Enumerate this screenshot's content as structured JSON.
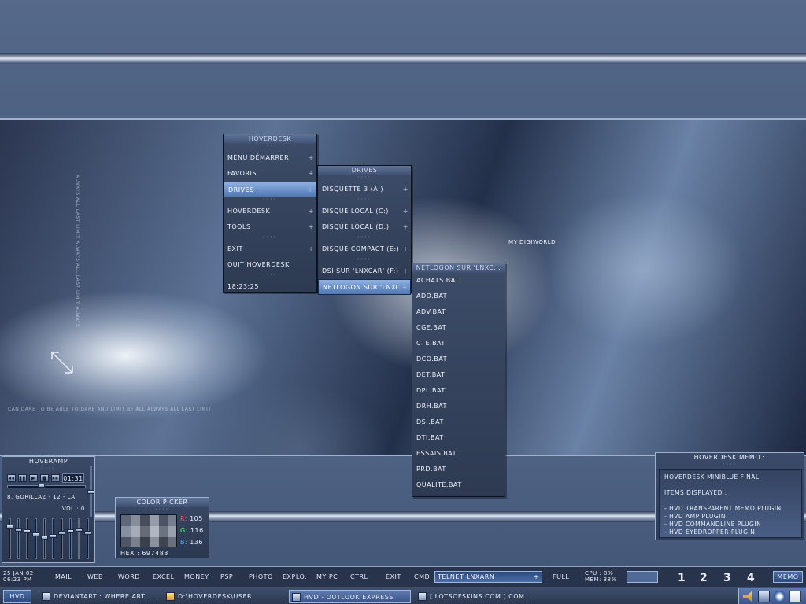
{
  "wallpaper": {
    "caption": "MY DIGIWORLD",
    "vertical_text": "ALWAYS ALL LAST LIMIT ALWAYS ALL LAST LIMIT ALWAYS",
    "bottom_text": "CAN DARE TO BE ABLE TO DARE AND LIMIT BE ALL ALWAYS ALL LAST LIMIT"
  },
  "menus": {
    "main": {
      "title": "HOVERDESK",
      "items": [
        "MENU DÉMARRER",
        "FAVORIS",
        "DRIVES",
        "HOVERDESK",
        "TOOLS",
        "EXIT",
        "QUIT HOVERDESK",
        "18:23:25"
      ]
    },
    "drives": {
      "title": "DRIVES",
      "items": [
        "DISQUETTE 3 (A:)",
        "DISQUE LOCAL (C:)",
        "DISQUE LOCAL (D:)",
        "DISQUE COMPACT (E:)",
        "DSI SUR 'LNXCAR' (F:)",
        "NETLOGON SUR 'LNXC..."
      ]
    },
    "netlogon": {
      "title": "NETLOGON SUR 'LNXC...",
      "items": [
        "ACHATS.BAT",
        "ADD.BAT",
        "ADV.BAT",
        "CGE.BAT",
        "CTE.BAT",
        "DCO.BAT",
        "DET.BAT",
        "DPL.BAT",
        "DRH.BAT",
        "DSI.BAT",
        "DTI.BAT",
        "ESSAIS.BAT",
        "PRD.BAT",
        "QUALITE.BAT"
      ]
    },
    "arrow": "+"
  },
  "hoveramp": {
    "title": "HOVERAMP",
    "time": "01:31",
    "track": "8. GORILLAZ - 12 - LA",
    "volume": "VOL : 0",
    "controls": [
      "◂◂",
      "▮▮",
      "▶",
      "■",
      "▸▸"
    ]
  },
  "color_picker": {
    "title": "COLOR PICKER",
    "r_label": "R:",
    "r_value": "105",
    "g_label": "G:",
    "g_value": "116",
    "b_label": "B:",
    "b_value": "136",
    "hex_label": "HEX : 697488",
    "swatch_color": "#697488"
  },
  "memo": {
    "title": "HOVERDESK MEMO :",
    "line1": "HOVERDESK MINIBLUE FINAL",
    "line2": "ITEMS DISPLAYED :",
    "items": [
      "- HVD TRANSPARENT MEMO PLUGIN",
      "- HVD AMP PLUGIN",
      "- HVD COMMANDLINE PLUGIN",
      "- HVD EYEDROPPER PLUGIN"
    ]
  },
  "taskbar": {
    "date": "25 JAN 02",
    "time": "06:23 PM",
    "links": [
      "MAIL",
      "WEB",
      "WORD",
      "EXCEL",
      "MONEY",
      "PSP",
      "PHOTO",
      "EXPLO.",
      "MY PC",
      "CTRL",
      "EXIT"
    ],
    "cmd_label": "CMD:",
    "cmd_value": "TELNET LNXARN",
    "full_label": "FULL",
    "cpu": "CPU : 0%",
    "mem": "MEM: 38%",
    "desktops": [
      "1",
      "2",
      "3",
      "4"
    ],
    "memo_button": "MEMO",
    "start_label": "HVD",
    "tasks": [
      "DEVIANTART : WHERE ART ...",
      "D:\\HOVERDESK\\USER",
      "HVD - OUTLOOK EXPRESS",
      "[ LOTSOFSKINS.COM ] COM..."
    ]
  },
  "colors": {
    "accent": "#4f77b3",
    "panel": "#2d3a52",
    "background": "#4a5d7d"
  }
}
